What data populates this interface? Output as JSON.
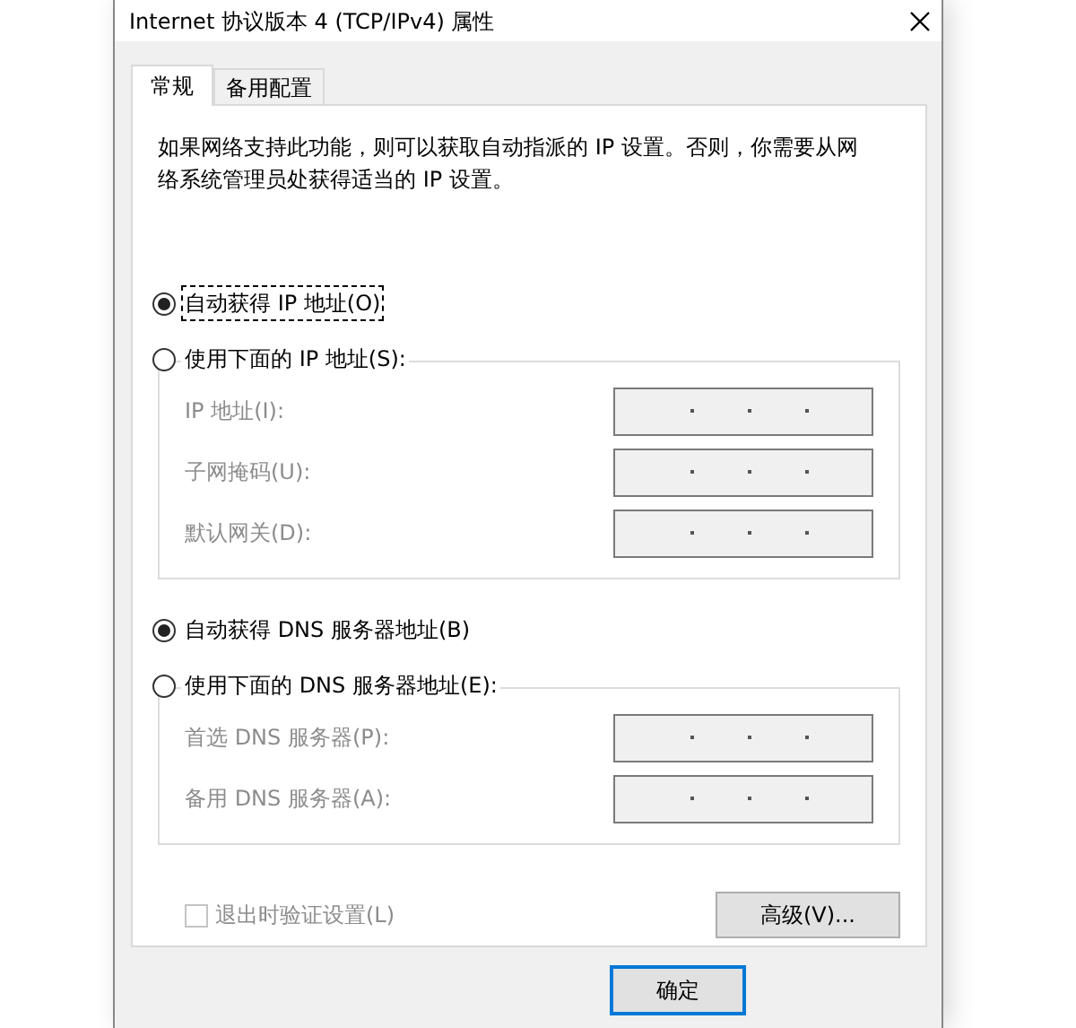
{
  "window": {
    "title": "Internet 协议版本 4 (TCP/IPv4) 属性"
  },
  "tabs": [
    {
      "label": "常规",
      "selected": true
    },
    {
      "label": "备用配置",
      "selected": false
    }
  ],
  "description": "如果网络支持此功能，则可以获取自动指派的 IP 设置。否则，你需要从网络系统管理员处获得适当的 IP 设置。",
  "ip_section": {
    "options": [
      {
        "label": "自动获得 IP 地址(O)",
        "selected": true,
        "focused": true
      },
      {
        "label": "使用下面的 IP 地址(S):",
        "selected": false,
        "focused": false
      }
    ],
    "fields": [
      {
        "label": "IP 地址(I):",
        "disabled": true
      },
      {
        "label": "子网掩码(U):",
        "disabled": true
      },
      {
        "label": "默认网关(D):",
        "disabled": true
      }
    ]
  },
  "dns_section": {
    "options": [
      {
        "label": "自动获得 DNS 服务器地址(B)",
        "selected": true,
        "focused": false
      },
      {
        "label": "使用下面的 DNS 服务器地址(E):",
        "selected": false,
        "focused": false
      }
    ],
    "fields": [
      {
        "label": "首选 DNS 服务器(P):",
        "disabled": true
      },
      {
        "label": "备用 DNS 服务器(A):",
        "disabled": true
      }
    ]
  },
  "validate_checkbox": {
    "label": "退出时验证设置(L)",
    "checked": false,
    "disabled": true
  },
  "advanced_button": "高级(V)...",
  "ok_button": {
    "label": "确定",
    "default": true
  }
}
